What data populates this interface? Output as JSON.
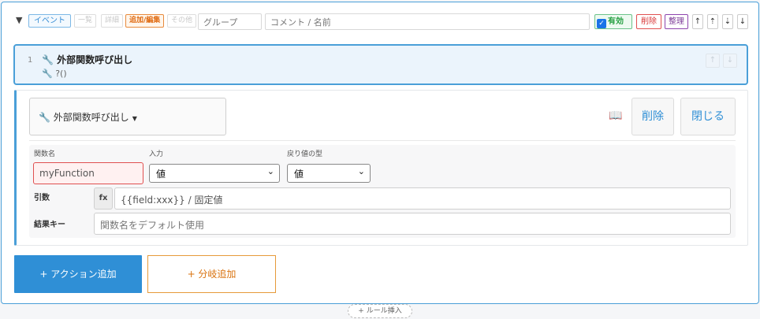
{
  "header": {
    "collapse_glyph": "▼",
    "tags": {
      "event": "イベント",
      "list": "一覧",
      "detail": "詳細",
      "edit": "追加/編集",
      "other": "その他"
    },
    "group_placeholder": "グループ",
    "comment_placeholder": "コメント / 名前",
    "enabled_label": "有効",
    "delete_label": "削除",
    "organize_label": "整理",
    "arrows": [
      "↑",
      "⇡",
      "⇣",
      "↓"
    ]
  },
  "action": {
    "number": "1",
    "title": "外部関数呼び出し",
    "subtitle": "?()",
    "icon": "wrench-icon",
    "up": "↑",
    "down": "↓"
  },
  "editor": {
    "type_label": "外部関数呼び出し",
    "delete_label": "削除",
    "close_label": "閉じる",
    "fields": {
      "function_name_label": "関数名",
      "function_name_value": "myFunction",
      "input_label": "入力",
      "input_value": "値",
      "return_type_label": "戻り値の型",
      "return_type_value": "値",
      "args_label": "引数",
      "fx_label": "fx",
      "args_placeholder": "{{field:xxx}} / 固定値",
      "result_key_label": "結果キー",
      "result_key_placeholder": "関数名をデフォルト使用"
    }
  },
  "buttons": {
    "add_action": "+ アクション追加",
    "add_branch": "+ 分岐追加",
    "insert_rule": "+ ルール挿入"
  },
  "colors": {
    "accent": "#2f8fd6",
    "danger": "#d83434",
    "branch": "#d9720e",
    "enabled": "#27a043"
  }
}
